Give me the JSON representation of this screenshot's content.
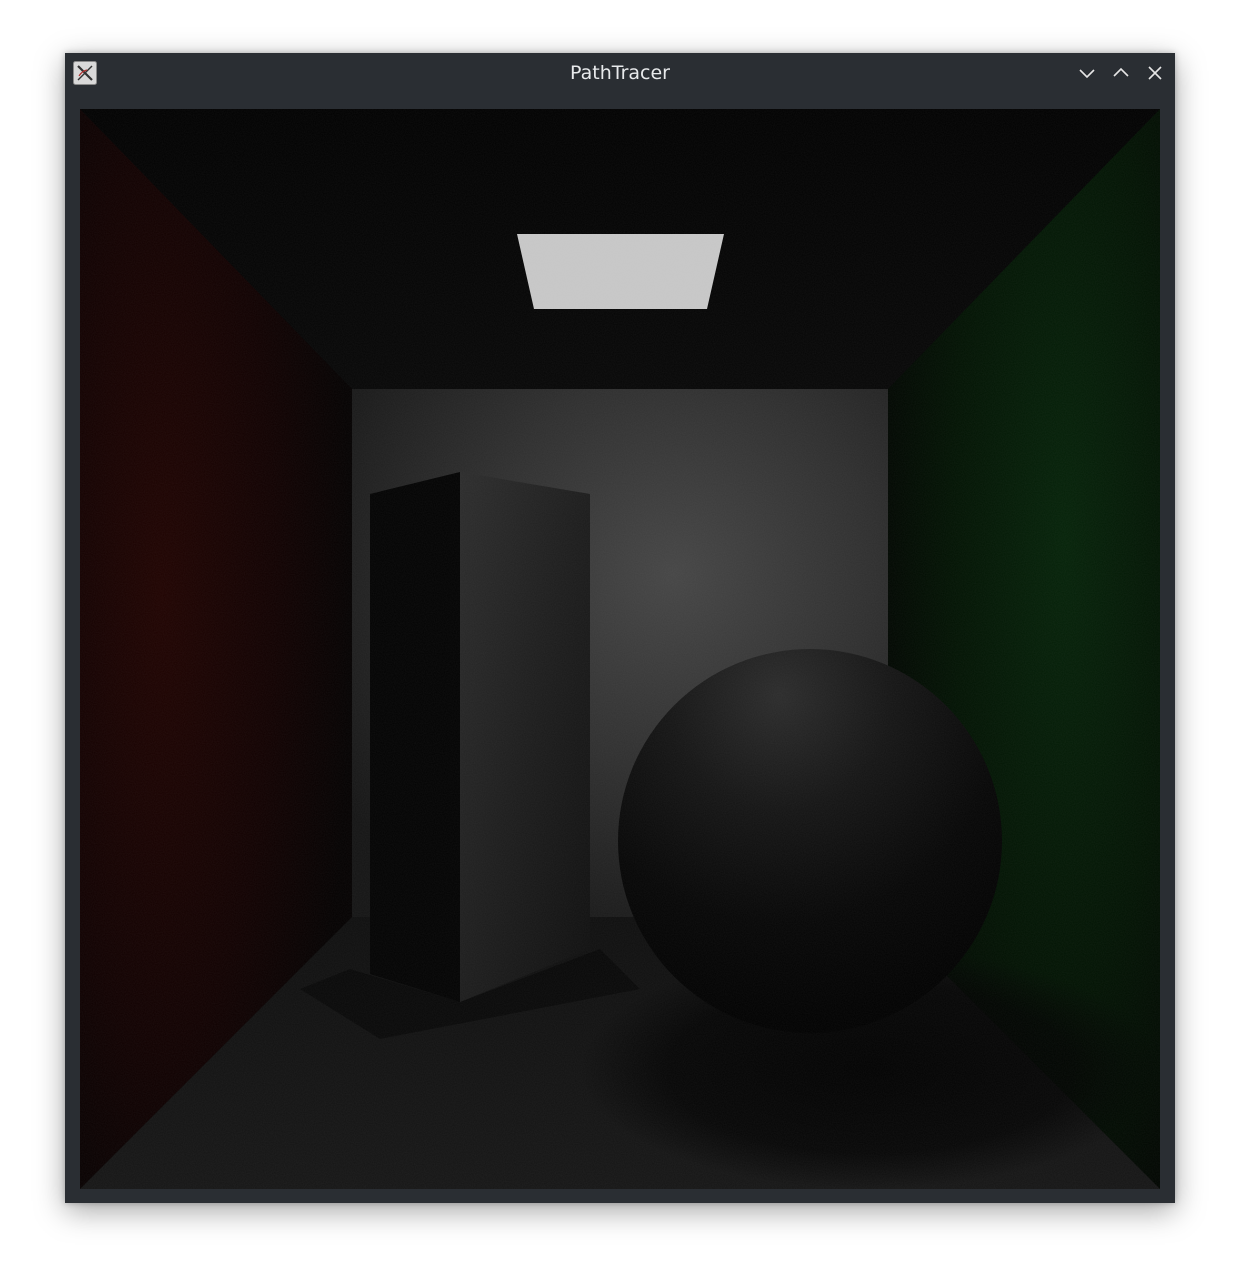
{
  "window": {
    "title": "PathTracer",
    "app_icon": "x11-app-icon",
    "controls": [
      {
        "name": "minimize",
        "icon": "chevron-down-icon"
      },
      {
        "name": "maximize",
        "icon": "chevron-up-icon"
      },
      {
        "name": "close",
        "icon": "close-icon"
      }
    ]
  },
  "render": {
    "scene": "cornell-box",
    "colors": {
      "left_wall": "#1f0000",
      "right_wall": "#001f00",
      "back_wall": "#3a3a3a",
      "floor": "#1a1a1a",
      "light": "#c8c8c8",
      "titlebar": "#2a2e33"
    }
  }
}
